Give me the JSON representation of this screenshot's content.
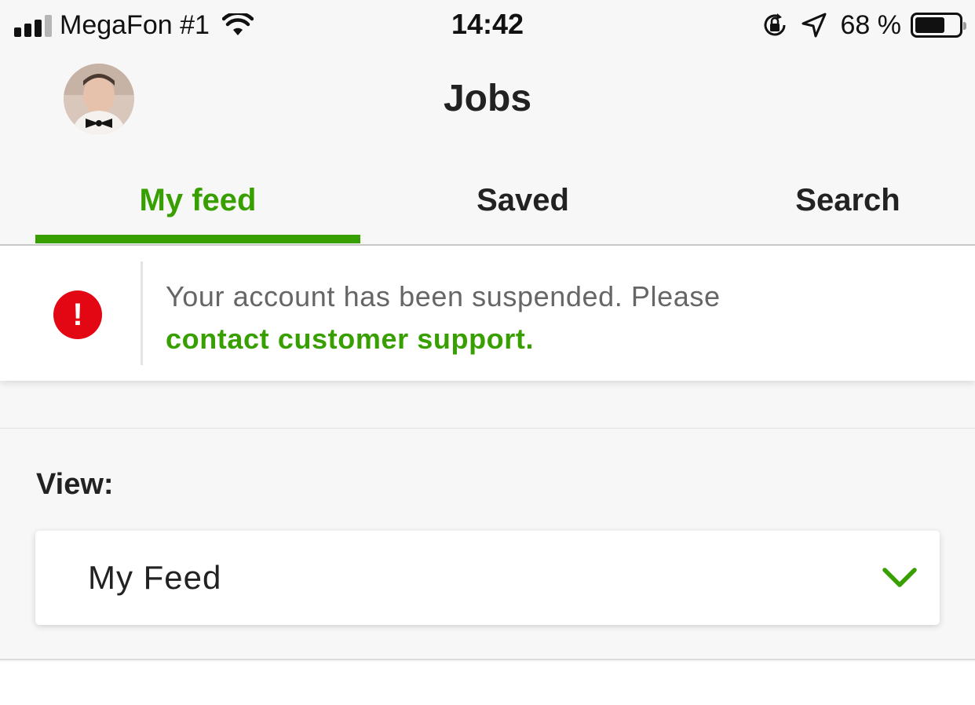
{
  "status_bar": {
    "carrier": "MegaFon #1",
    "time": "14:42",
    "battery_percent_label": "68 %",
    "battery_level": 0.68,
    "icons": [
      "signal-icon",
      "wifi-icon",
      "orientation-lock-icon",
      "location-arrow-icon",
      "battery-icon"
    ]
  },
  "header": {
    "title": "Jobs",
    "avatar_icon": "user-avatar"
  },
  "tabs": [
    {
      "label": "My feed",
      "active": true
    },
    {
      "label": "Saved",
      "active": false
    },
    {
      "label": "Search",
      "active": false
    }
  ],
  "alert": {
    "icon": "exclamation-icon",
    "icon_glyph": "!",
    "message": "Your account has been suspended. Please",
    "link_text": "contact customer support."
  },
  "view": {
    "label": "View:",
    "selected": "My Feed",
    "icon": "chevron-down-icon"
  },
  "colors": {
    "accent": "#37a000",
    "error": "#e30613",
    "background": "#f7f7f7"
  }
}
